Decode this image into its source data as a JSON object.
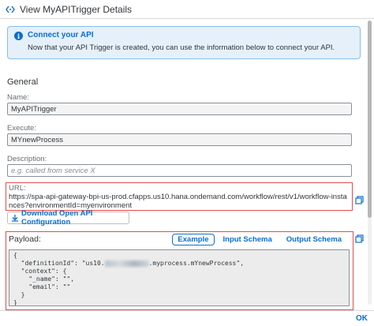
{
  "dialog": {
    "title": "View MyAPITrigger Details",
    "icon": "api-icon",
    "ok_label": "OK"
  },
  "info": {
    "title": "Connect your API",
    "text": "Now that your API Trigger is created, you can use the information below to connect your API.",
    "icon": "info-icon"
  },
  "general": {
    "section_title": "General",
    "name_label": "Name:",
    "name_value": "MyAPITrigger",
    "execute_label": "Execute:",
    "execute_value": "MYnewProcess",
    "description_label": "Description:",
    "description_placeholder": "e.g. called from service X"
  },
  "url": {
    "label": "URL:",
    "value": "https://spa-api-gateway-bpi-us-prod.cfapps.us10.hana.ondemand.com/workflow/rest/v1/workflow-instances?environmentId=myenvironment"
  },
  "download": {
    "label": "Download Open API Configuration"
  },
  "payload": {
    "label": "Payload:",
    "tabs": [
      "Example",
      "Input Schema",
      "Output Schema"
    ],
    "active_tab": "Example",
    "lines": {
      "l1": "{",
      "l2_start": "  \"definitionId\": \"us10.",
      "l2_end": ".myprocess.mYnewProcess\",",
      "l3": "  \"context\": {",
      "l4": "    \"_name\": \"\",",
      "l5": "    \"email\": \"\"",
      "l6": "  }",
      "l7": "}"
    }
  },
  "colors": {
    "accent": "#0a6ed1",
    "highlight_border": "#e04d4d",
    "info_background": "#e5f0fa"
  }
}
